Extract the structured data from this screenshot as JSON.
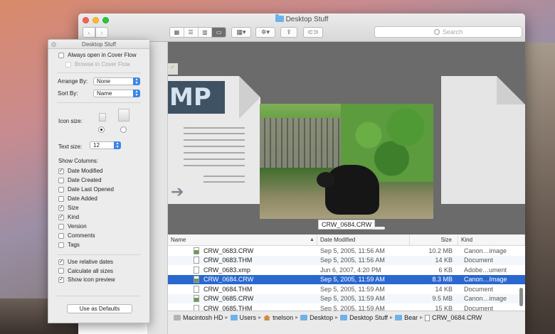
{
  "window": {
    "title": "Desktop Stuff",
    "search_placeholder": "Search"
  },
  "toolbar": {
    "view_buttons": [
      "icon-view",
      "list-view",
      "column-view",
      "cover-flow-view"
    ],
    "arrange_icon": "grid-arrange-icon",
    "action_icon": "gear-icon",
    "share_icon": "share-icon",
    "tag_icon": "tag-icon"
  },
  "coverflow": {
    "caption": "CRW_0684.CRW",
    "left_doc_text": "MP"
  },
  "list": {
    "headers": {
      "name": "Name",
      "date": "Date Modified",
      "size": "Size",
      "kind": "Kind"
    },
    "rows": [
      {
        "name": "CRW_0683.CRW",
        "date": "Sep 5, 2005, 11:56 AM",
        "size": "10.2 MB",
        "kind": "Canon…image",
        "icon": "img",
        "selected": false
      },
      {
        "name": "CRW_0683.THM",
        "date": "Sep 5, 2005, 11:56 AM",
        "size": "14 KB",
        "kind": "Document",
        "icon": "doc",
        "selected": false
      },
      {
        "name": "CRW_0683.xmp",
        "date": "Jun 6, 2007, 4:20 PM",
        "size": "6 KB",
        "kind": "Adobe…ument",
        "icon": "doc",
        "selected": false
      },
      {
        "name": "CRW_0684.CRW",
        "date": "Sep 5, 2005, 11:59 AM",
        "size": "8.3 MB",
        "kind": "Canon…Image",
        "icon": "img",
        "selected": true
      },
      {
        "name": "CRW_0684.THM",
        "date": "Sep 5, 2005, 11:59 AM",
        "size": "14 KB",
        "kind": "Document",
        "icon": "doc",
        "selected": false
      },
      {
        "name": "CRW_0685.CRW",
        "date": "Sep 5, 2005, 11:59 AM",
        "size": "9.5 MB",
        "kind": "Canon…image",
        "icon": "img",
        "selected": false
      },
      {
        "name": "CRW_0685.THM",
        "date": "Sep 5, 2005, 11:59 AM",
        "size": "15 KB",
        "kind": "Document",
        "icon": "doc",
        "selected": false
      }
    ]
  },
  "pathbar": [
    {
      "label": "Macintosh HD",
      "icon": "hd"
    },
    {
      "label": "Users",
      "icon": "folder"
    },
    {
      "label": "tnelson",
      "icon": "home"
    },
    {
      "label": "Desktop",
      "icon": "folder"
    },
    {
      "label": "Desktop Stuff",
      "icon": "folder"
    },
    {
      "label": "Bear",
      "icon": "folder"
    },
    {
      "label": "CRW_0684.CRW",
      "icon": "doc"
    }
  ],
  "panel": {
    "title": "Desktop Stuff",
    "always_open": "Always open in Cover Flow",
    "browse_in": "Browse in Cover Flow",
    "arrange_by_label": "Arrange By:",
    "arrange_by_value": "None",
    "sort_by_label": "Sort By:",
    "sort_by_value": "Name",
    "icon_size_label": "Icon size:",
    "text_size_label": "Text size:",
    "text_size_value": "12",
    "show_columns_label": "Show Columns:",
    "columns": [
      {
        "label": "Date Modified",
        "checked": true
      },
      {
        "label": "Date Created",
        "checked": false
      },
      {
        "label": "Date Last Opened",
        "checked": false
      },
      {
        "label": "Date Added",
        "checked": false
      },
      {
        "label": "Size",
        "checked": true
      },
      {
        "label": "Kind",
        "checked": true
      },
      {
        "label": "Version",
        "checked": false
      },
      {
        "label": "Comments",
        "checked": false
      },
      {
        "label": "Tags",
        "checked": false
      }
    ],
    "options": [
      {
        "label": "Use relative dates",
        "checked": true
      },
      {
        "label": "Calculate all sizes",
        "checked": false
      },
      {
        "label": "Show icon preview",
        "checked": true
      }
    ],
    "defaults_button": "Use as Defaults"
  }
}
